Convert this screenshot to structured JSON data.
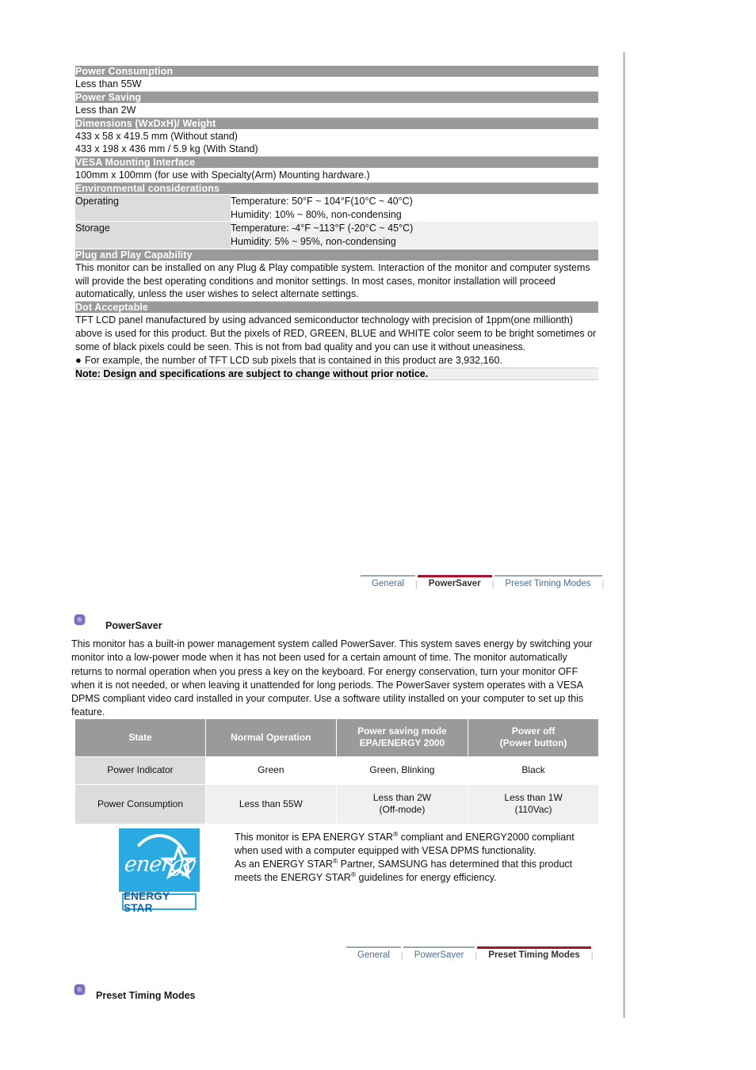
{
  "spec_table": {
    "sections": [
      {
        "type": "header",
        "label": "Power Consumption"
      },
      {
        "type": "body",
        "lines": [
          "Less than 55W"
        ]
      },
      {
        "type": "header",
        "label": "Power Saving"
      },
      {
        "type": "body",
        "lines": [
          "Less than 2W"
        ]
      },
      {
        "type": "header",
        "label": "Dimensions (WxDxH)/ Weight"
      },
      {
        "type": "body",
        "lines": [
          "433 x 58 x 419.5 mm (Without stand)",
          "433 x 198 x 436 mm / 5.9 kg (With Stand)"
        ]
      },
      {
        "type": "header",
        "label": "VESA Mounting Interface"
      },
      {
        "type": "body",
        "lines": [
          "100mm x 100mm (for use with Specialty(Arm) Mounting hardware.)"
        ]
      },
      {
        "type": "header",
        "label": "Environmental considerations"
      }
    ],
    "power_consumption_header": "Power Consumption",
    "power_consumption_value": "Less than 55W",
    "power_saving_header": "Power Saving",
    "power_saving_value": "Less than 2W",
    "dimensions_header": "Dimensions (WxDxH)/ Weight",
    "dimensions_line1": "433 x 58 x 419.5 mm (Without stand)",
    "dimensions_line2": "433 x 198 x 436 mm / 5.9 kg (With Stand)",
    "vesa_header": "VESA Mounting Interface",
    "vesa_value": "100mm x 100mm (for use with Specialty(Arm) Mounting hardware.)",
    "environmental_header": "Environmental considerations",
    "operating_label": "Operating",
    "operating_temp": "Temperature: 50°F ~ 104°F(10°C ~ 40°C)",
    "operating_humidity": "Humidity: 10% ~ 80%, non-condensing",
    "storage_label": "Storage",
    "storage_temp": "Temperature: -4°F ~113°F (-20°C ~ 45°C)",
    "storage_humidity": "Humidity: 5% ~ 95%, non-condensing",
    "plug_play_header": "Plug and Play Capability",
    "plug_play_body": "This monitor can be installed on any Plug & Play compatible system. Interaction of the monitor and computer systems will provide the best operating conditions and monitor settings. In most cases, monitor installation will proceed automatically, unless the user wishes to select alternate settings.",
    "dot_acceptable_header": "Dot Acceptable",
    "dot_acceptable_body": "TFT LCD panel manufactured by using advanced semiconductor technology with precision of 1ppm(one millionth) above is used for this product. But the pixels of RED, GREEN, BLUE and WHITE color seem to be bright sometimes or some of black pixels could be seen. This is not from bad quality and you can use it without uneasiness.",
    "dot_acceptable_bullet": "For example, the number of TFT LCD sub pixels that is contained in this product are 3,932,160.",
    "bullet_glyph": "●",
    "note": "Note: Design and specifications are subject to change without prior notice."
  },
  "tabbar_top": {
    "tabs": [
      {
        "label": "General",
        "active": false
      },
      {
        "label": "PowerSaver",
        "active": true
      },
      {
        "label": "Preset Timing Modes",
        "active": false
      }
    ],
    "separator": "|",
    "active_color": "#a8122c",
    "inactive_color": "#4a6f94"
  },
  "tabbar_bottom": {
    "tabs": [
      {
        "label": "General",
        "active": false
      },
      {
        "label": "PowerSaver",
        "active": false
      },
      {
        "label": "Preset Timing Modes",
        "active": true
      }
    ],
    "separator": "|",
    "active_color": "#a8122c",
    "inactive_color": "#4a6f94"
  },
  "powersaver_section": {
    "title": "PowerSaver",
    "body": "This monitor has a built-in power management system called PowerSaver. This system saves energy by switching your monitor into a low-power mode when it has not been used for a certain amount of time. The monitor automatically returns to normal operation when you press a key on the keyboard. For energy conservation, turn your monitor OFF when it is not needed, or when leaving it unattended for long periods. The PowerSaver system operates with a VESA DPMS compliant video card installed in your computer. Use a software utility installed on your computer to set up this feature."
  },
  "powersaver_table": {
    "headers": [
      "State",
      "Normal Operation",
      "Power saving mode\nEPA/ENERGY 2000",
      "Power off\n(Power button)"
    ],
    "header_state": "State",
    "header_normal": "Normal Operation",
    "header_saving_l1": "Power saving mode",
    "header_saving_l2": "EPA/ENERGY 2000",
    "header_off_l1": "Power off",
    "header_off_l2": "(Power button)",
    "rows": [
      {
        "label": "Power Indicator",
        "normal": "Green",
        "saving_l1": "Green, Blinking",
        "saving_l2": "",
        "off_l1": "Black",
        "off_l2": ""
      },
      {
        "label": "Power Consumption",
        "normal": "Less than 55W",
        "saving_l1": "Less than 2W",
        "saving_l2": "(Off-mode)",
        "off_l1": "Less than 1W",
        "off_l2": "(110Vac)"
      }
    ]
  },
  "energy_star": {
    "logo_word": "energy",
    "logo_bar_text": "ENERGY STAR",
    "logo_bg_color": "#29abe2",
    "logo_text_color": "#0f62a8",
    "para1_a": "This monitor is EPA ENERGY STAR",
    "para1_sup": "®",
    "para1_b": " compliant and ENERGY2000 compliant when used with a computer equipped with VESA DPMS functionality.",
    "para2_a": "As an ENERGY STAR",
    "para2_sup": "®",
    "para2_b": " Partner, SAMSUNG has determined that this product meets the ENERGY STAR",
    "para2_sup2": "®",
    "para2_c": " guidelines for energy efficiency."
  },
  "preset_section": {
    "title": "Preset Timing Modes"
  }
}
